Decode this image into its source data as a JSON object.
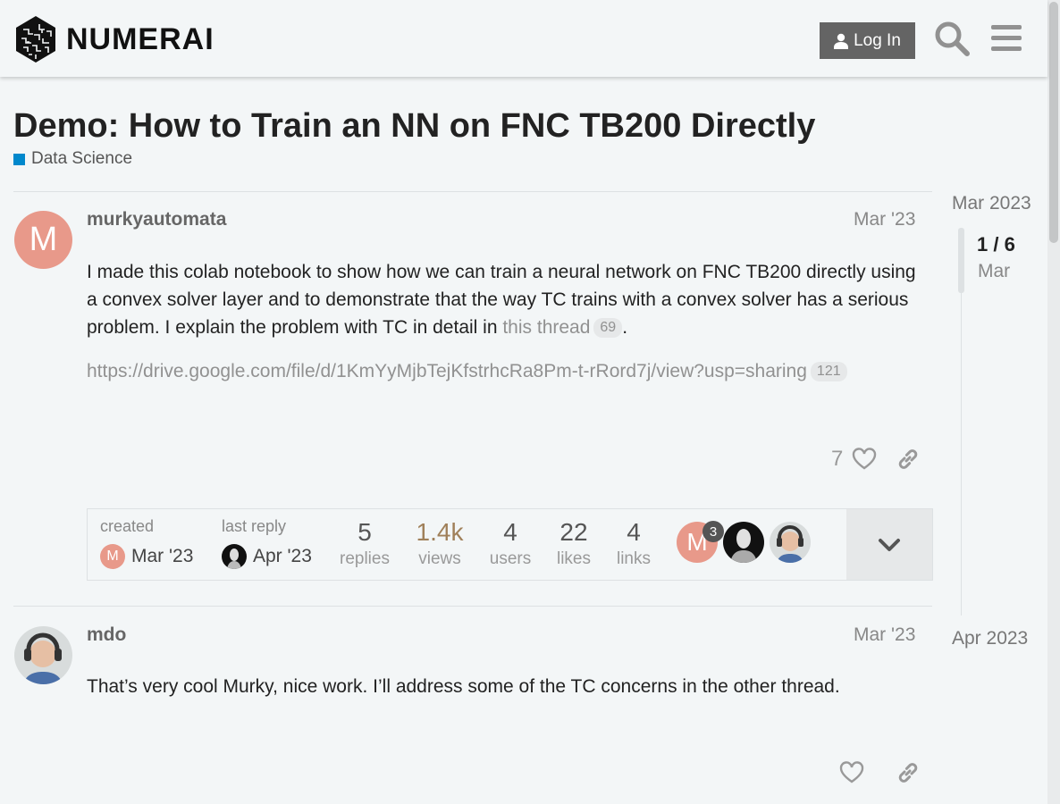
{
  "header": {
    "brand": "NUMERAI",
    "login_label": "Log In"
  },
  "topic": {
    "title": "Demo: How to Train an NN on FNC TB200 Directly",
    "category": "Data Science",
    "category_color": "#0088cc"
  },
  "posts": [
    {
      "username": "murkyautomata",
      "avatar_letter": "M",
      "date": "Mar '23",
      "body_start": "I made this colab notebook to show how we can train a neural network on FNC TB200 directly using a convex solver layer and to demonstrate that the way TC trains with a convex solver has a serious problem. I explain the problem with TC in detail in ",
      "thread_link": "this thread",
      "thread_clicks": "69",
      "body_end": ".",
      "link_url": "https://drive.google.com/file/d/1KmYyMjbTejKfstrhcRa8Pm-t-rRord7j/view?usp=sharing",
      "link_clicks": "121",
      "likes": "7"
    },
    {
      "username": "mdo",
      "date": "Mar '23",
      "body": "That’s very cool Murky, nice work. I’ll address some of the TC concerns in the other thread."
    }
  ],
  "topic_map": {
    "created_label": "created",
    "created_date": "Mar '23",
    "created_avatar_letter": "M",
    "last_reply_label": "last reply",
    "last_reply_date": "Apr '23",
    "stats": [
      {
        "num": "5",
        "label": "replies"
      },
      {
        "num": "1.4k",
        "label": "views"
      },
      {
        "num": "4",
        "label": "users"
      },
      {
        "num": "22",
        "label": "likes"
      },
      {
        "num": "4",
        "label": "links"
      }
    ],
    "participant_letter": "M",
    "participant_count": "3"
  },
  "timeline": {
    "start": "Mar 2023",
    "position": "1 / 6",
    "position_date": "Mar",
    "end": "Apr 2023"
  },
  "colors": {
    "views_highlight": "#a0805a",
    "avatar_m": "#e8998a"
  }
}
